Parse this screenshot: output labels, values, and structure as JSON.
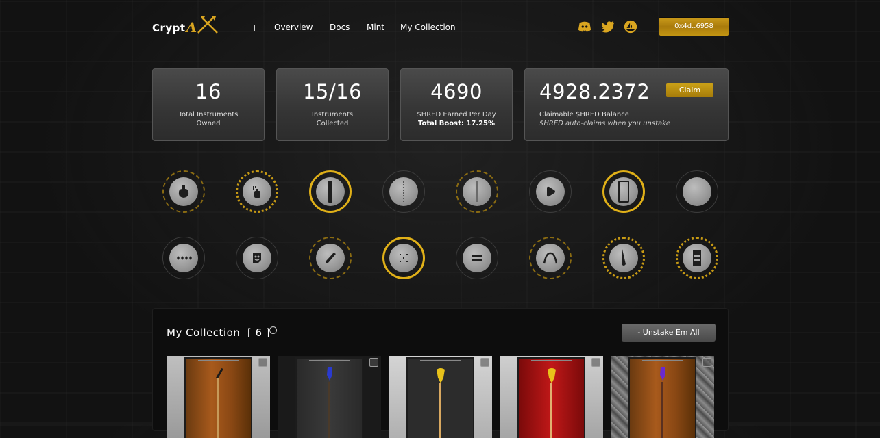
{
  "header": {
    "logo_text": "Crypt",
    "logo_accent": "A",
    "nav": [
      "Overview",
      "Docs",
      "Mint",
      "My Collection"
    ],
    "social_icons": [
      "discord-icon",
      "twitter-icon",
      "opensea-icon"
    ],
    "wallet": "0x4d..6958"
  },
  "stats": [
    {
      "value": "16",
      "label_line1": "Total Instruments",
      "label_line2": "Owned"
    },
    {
      "value": "15/16",
      "label_line1": "Instruments",
      "label_line2": "Collected"
    },
    {
      "value": "4690",
      "label_line1": "$HRED Earned Per Day",
      "label_line2": "Total Boost: 17.25%"
    },
    {
      "value": "4928.2372",
      "label_line1": "Claimable $HRED Balance",
      "label_line2": "$HRED auto-claims when you unstake",
      "button": "Claim"
    }
  ],
  "accent_color": "#d9a520",
  "instruments": {
    "row1": [
      "guitar-body-icon",
      "amp-icon",
      "pickup-single-icon",
      "neck-icon",
      "fretboard-icon",
      "pick-icon",
      "pickguard-icon",
      "blank-icon"
    ],
    "row2": [
      "tuners-icon",
      "stompbox-icon",
      "pick-angle-icon",
      "bridge-icon",
      "knobs-icon",
      "strap-icon",
      "headstock-icon",
      "cabinet-icon"
    ]
  },
  "collection": {
    "title": "My Collection",
    "count": "[ 6 ]",
    "info": "i",
    "unstake_button": "- Unstake Em All"
  }
}
